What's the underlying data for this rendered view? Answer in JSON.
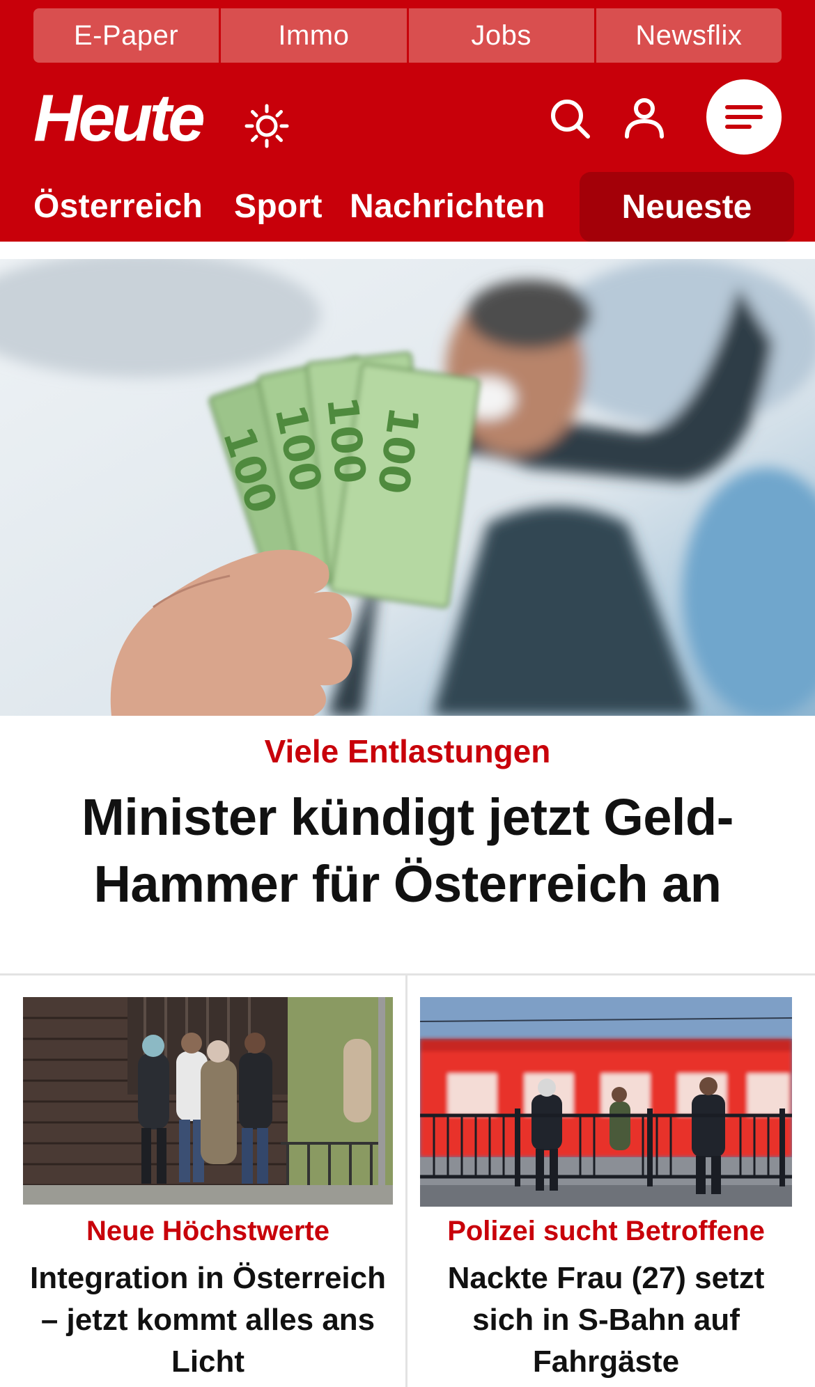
{
  "top_links": [
    "E-Paper",
    "Immo",
    "Jobs",
    "Newsflix"
  ],
  "logo": "Heute",
  "nav": {
    "items": [
      "Österreich",
      "Sport",
      "Nachrichten"
    ],
    "highlight": "Neueste"
  },
  "hero": {
    "kicker": "Viele Entlastungen",
    "title": "Minister kündigt jetzt Geld-Hammer für Österreich an",
    "banknote_label": "100"
  },
  "teasers": [
    {
      "kicker": "Neue Höchstwerte",
      "title": "Integration in Österreich – jetzt kommt alles ans Licht"
    },
    {
      "kicker": "Polizei sucht Betroffene",
      "title": "Nackte Frau (27) setzt sich in S-Bahn auf Fahrgäste"
    }
  ],
  "colors": {
    "brand_red": "#c8000a",
    "nav_dark_red": "#a30008",
    "link_tab": "#d94f4f"
  },
  "icons": [
    "sun-icon",
    "search-icon",
    "user-icon",
    "menu-icon"
  ]
}
